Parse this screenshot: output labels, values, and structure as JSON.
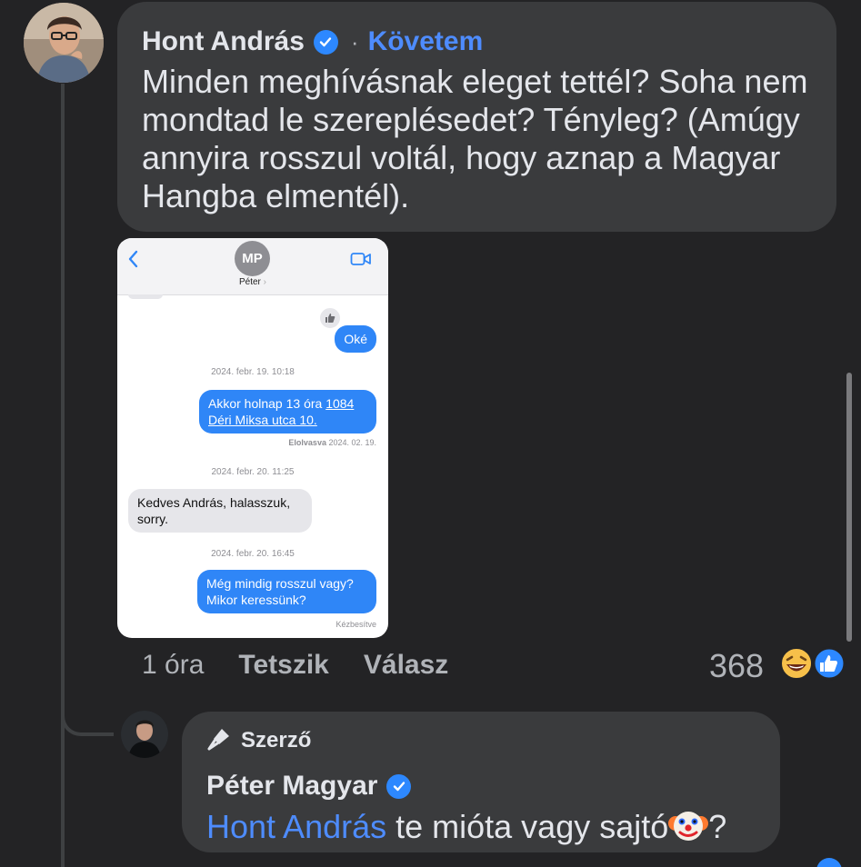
{
  "comment": {
    "author": "Hont András",
    "separator": "·",
    "follow_label": "Követem",
    "text": "Minden meghívásnak eleget tettél? Soha nem mondtad le szereplésedet? Tényleg? (Amúgy annyira rosszul voltál, hogy aznap a Magyar Hangba elmentél).",
    "actions": {
      "time": "1 óra",
      "like": "Tetszik",
      "reply": "Válasz"
    },
    "reaction_count": "368",
    "reaction_icons": [
      "laughing-emoji-icon",
      "like-icon"
    ]
  },
  "attachment": {
    "contact_initials": "MP",
    "contact_name": "Péter",
    "contact_chevron": "›",
    "messages": [
      {
        "type": "out",
        "text": "Oké"
      },
      {
        "type": "time",
        "text": "2024. febr. 19. 10:18"
      },
      {
        "type": "out",
        "text_line1_pre": "Akkor holnap 13 óra ",
        "text_line1_link": "1084",
        "text_line2": "Déri Miksa utca 10."
      },
      {
        "type": "status",
        "text_bold": "Elolvasva",
        "text": " 2024. 02. 19."
      },
      {
        "type": "time",
        "text": "2024. febr. 20. 11:25"
      },
      {
        "type": "in",
        "line1": "Kedves András, halasszuk,",
        "line2": "sorry."
      },
      {
        "type": "time",
        "text": "2024. febr. 20. 16:45"
      },
      {
        "type": "out",
        "line1": "Még mindig rosszul vagy?",
        "line2": "Mikor keressünk?"
      },
      {
        "type": "status",
        "text": "Kézbesítve"
      }
    ]
  },
  "reply": {
    "badge": "Szerző",
    "author": "Péter Magyar",
    "mention": "Hont András",
    "text": " te mióta vagy sajtó",
    "emoji": "clown-emoji-icon",
    "text_end": "?"
  },
  "colors": {
    "background": "#232325",
    "bubble": "#3a3b3d",
    "link": "#4e8cff",
    "verified": "#2d88ff",
    "imessage_blue": "#2f86f7"
  }
}
